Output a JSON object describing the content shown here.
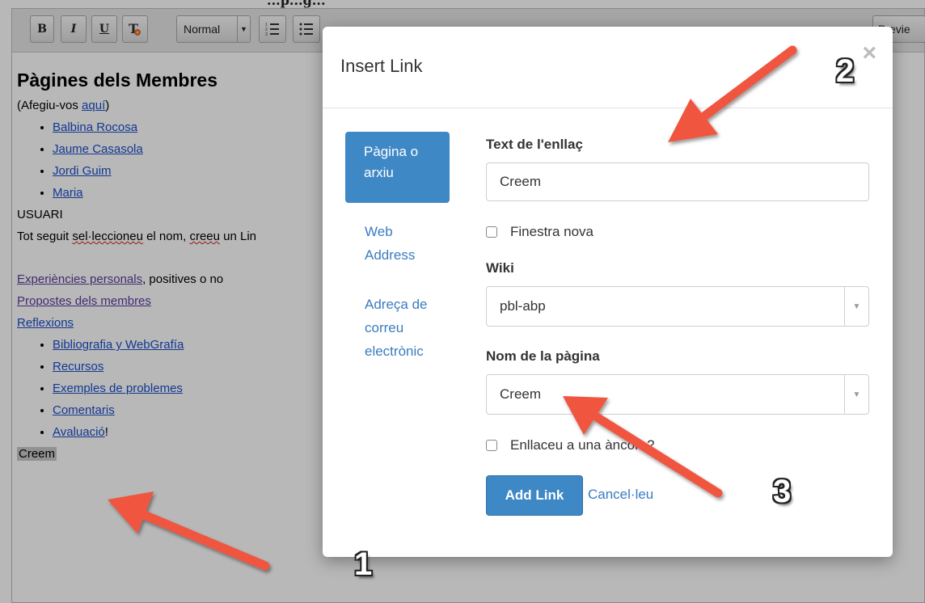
{
  "header": {
    "title_fragment": "...p...g..."
  },
  "toolbar": {
    "bold_label": "B",
    "italic_label": "I",
    "underline_label": "U",
    "text_color_icon": "text-color-icon",
    "format_select": "Normal",
    "preview_label": "Previe"
  },
  "page": {
    "heading": "Pàgines dels Membres",
    "join_prefix": "(Afegiu-vos ",
    "join_link": "aquí",
    "join_suffix": ")",
    "members": [
      "Balbina Rocosa",
      "Jaume Casasola",
      "Jordi Guim",
      "Maria"
    ],
    "usuari": "USUARI",
    "instruction_a": "Tot seguit ",
    "instruction_b": "sel·leccioneu",
    "instruction_c": " el nom, ",
    "instruction_d": "creeu",
    "instruction_e": " un Lin",
    "experiences_link": "Experiències personals",
    "experiences_suffix": ", positives o no",
    "proposals_link": "Propostes dels membres",
    "reflections_link": "Reflexions",
    "resources": [
      "Bibliografia y WebGrafía",
      "Recursos",
      "Exemples de problemes",
      "Comentaris",
      "Avaluació"
    ],
    "resources_last_suffix": "!",
    "selected_word": "Creem"
  },
  "modal": {
    "title": "Insert Link",
    "close_symbol": "×",
    "tabs": {
      "page_or_file": "Pàgina o arxiu",
      "web_address": "Web Address",
      "email": "Adreça de correu electrònic"
    },
    "link_text_label": "Text de l'enllaç",
    "link_text_value": "Creem",
    "new_window_label": "Finestra nova",
    "wiki_label": "Wiki",
    "wiki_value": "pbl-abp",
    "page_name_label": "Nom de la pàgina",
    "page_name_value": "Creem",
    "anchor_label": "Enllaceu a una àncora?",
    "add_button": "Add Link",
    "cancel_link": "Cancel·leu"
  },
  "annotations": {
    "step1": "1",
    "step2": "2",
    "step3": "3",
    "arrow_color": "#f0553f"
  }
}
